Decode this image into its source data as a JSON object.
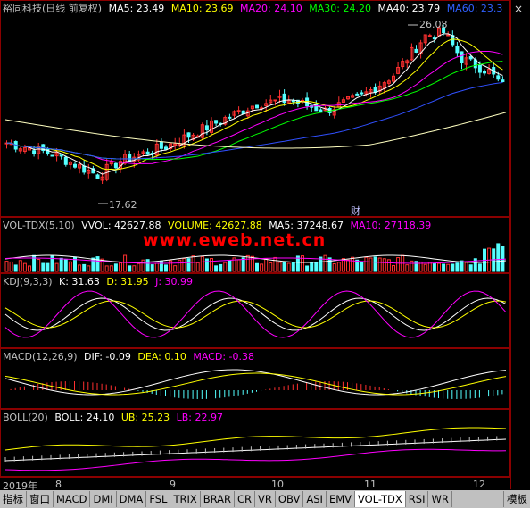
{
  "main": {
    "title": "裕同科技(日线 前复权)",
    "ma": [
      {
        "label": "MA5: 23.49",
        "color": "#ffffff"
      },
      {
        "label": "MA10: 23.69",
        "color": "#ffff00"
      },
      {
        "label": "MA20: 24.10",
        "color": "#ff00ff"
      },
      {
        "label": "MA30: 24.20",
        "color": "#00ff00"
      },
      {
        "label": "MA40: 23.79",
        "color": "#ffffff"
      },
      {
        "label": "MA60: 23.3",
        "color": "#0000ff"
      }
    ],
    "high_label": "26.08",
    "low_label": "17.62",
    "marker": "财"
  },
  "vol": {
    "items": [
      {
        "label": "VOL-TDX(5,10)",
        "color": "#c0c0c0"
      },
      {
        "label": "VVOL: 42627.88",
        "color": "#ffffff"
      },
      {
        "label": "VOLUME: 42627.88",
        "color": "#ffff00"
      },
      {
        "label": "MA5: 37248.67",
        "color": "#ffffff"
      },
      {
        "label": "MA10: 27118.39",
        "color": "#ff00ff"
      }
    ]
  },
  "watermark": "www.eweb.net.cn",
  "kdj": {
    "items": [
      {
        "label": "KDJ(9,3,3)",
        "color": "#c0c0c0"
      },
      {
        "label": "K: 31.63",
        "color": "#ffffff"
      },
      {
        "label": "D: 31.95",
        "color": "#ffff00"
      },
      {
        "label": "J: 30.99",
        "color": "#ff00ff"
      }
    ]
  },
  "macd": {
    "items": [
      {
        "label": "MACD(12,26,9)",
        "color": "#c0c0c0"
      },
      {
        "label": "DIF: -0.09",
        "color": "#ffffff"
      },
      {
        "label": "DEA: 0.10",
        "color": "#ffff00"
      },
      {
        "label": "MACD: -0.38",
        "color": "#ff00ff"
      }
    ]
  },
  "boll": {
    "items": [
      {
        "label": "BOLL(20)",
        "color": "#c0c0c0"
      },
      {
        "label": "BOLL: 24.10",
        "color": "#ffffff"
      },
      {
        "label": "UB: 25.23",
        "color": "#ffff00"
      },
      {
        "label": "LB: 22.97",
        "color": "#ff00ff"
      }
    ]
  },
  "dates": [
    "2019年",
    "8",
    "9",
    "10",
    "11",
    "12"
  ],
  "tabs": [
    "指标",
    "窗口",
    "MACD",
    "DMI",
    "DMA",
    "FSL",
    "TRIX",
    "BRAR",
    "CR",
    "VR",
    "OBV",
    "ASI",
    "EMV",
    "VOL-TDX",
    "RSI",
    "WR",
    "模板"
  ],
  "selected_tab": "VOL-TDX",
  "close_label": "×"
}
